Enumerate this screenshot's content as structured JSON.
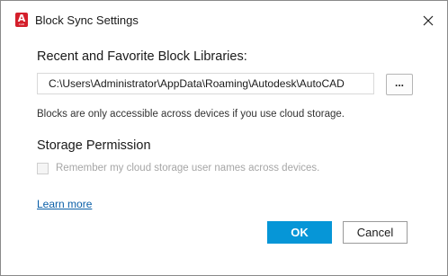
{
  "window": {
    "title": "Block Sync Settings",
    "app_icon_letter": "A",
    "app_icon_sub": "CAD",
    "app_icon_color": "#d41f2b",
    "close_icon": "close-icon"
  },
  "libraries": {
    "heading": "Recent and Favorite Block Libraries:",
    "path_value": "C:\\Users\\Administrator\\AppData\\Roaming\\Autodesk\\AutoCAD",
    "browse_label": "...",
    "info_text": "Blocks are only accessible across devices if you use cloud storage."
  },
  "permission": {
    "heading": "Storage Permission",
    "checkbox_label": "Remember my cloud storage user names across devices.",
    "checkbox_checked": false,
    "checkbox_disabled": true
  },
  "links": {
    "learn_more": "Learn more"
  },
  "footer": {
    "ok_label": "OK",
    "cancel_label": "Cancel",
    "ok_color": "#0696d7"
  }
}
